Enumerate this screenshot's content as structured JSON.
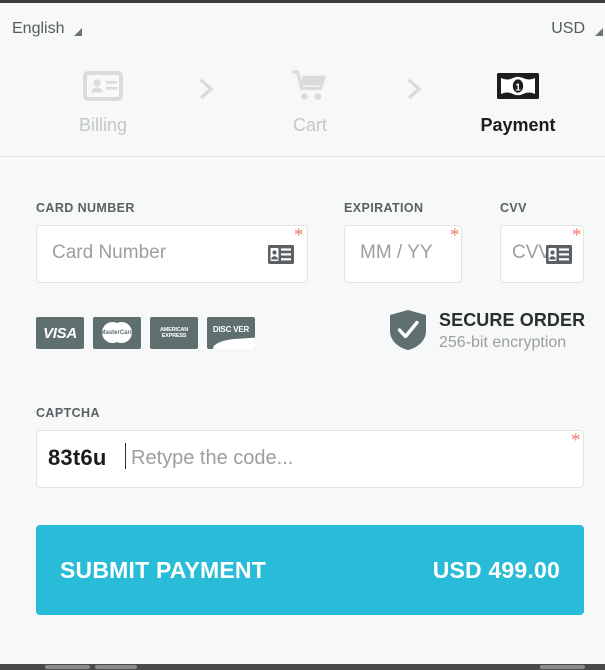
{
  "topbar": {
    "language": "English",
    "currency": "USD",
    "language_caret_icon": "caret-down-icon",
    "currency_caret_icon": "caret-down-icon"
  },
  "steps": [
    {
      "label": "Billing",
      "icon": "id-card-icon",
      "active": false
    },
    {
      "label": "Cart",
      "icon": "shopping-cart-icon",
      "active": false
    },
    {
      "label": "Payment",
      "icon": "banknote-icon",
      "active": true
    }
  ],
  "separators": [
    "chevron-right-icon",
    "chevron-right-icon"
  ],
  "form": {
    "card_number": {
      "label": "CARD NUMBER",
      "placeholder": "Card Number",
      "value": "",
      "required_marker": "*",
      "icon": "credit-card-icon"
    },
    "expiration": {
      "label": "EXPIRATION",
      "placeholder": "MM / YY",
      "value": "",
      "required_marker": "*"
    },
    "cvv": {
      "label": "CVV",
      "placeholder": "CVV",
      "value": "",
      "required_marker": "*",
      "icon": "credit-card-icon"
    },
    "captcha": {
      "label": "CAPTCHA",
      "code": "83t6u",
      "placeholder": "Retype the code...",
      "value": "",
      "required_marker": "*"
    }
  },
  "card_brands": [
    {
      "name": "VISA",
      "text": "VISA"
    },
    {
      "name": "MasterCard",
      "text": "MasterCard"
    },
    {
      "name": "American Express",
      "line1": "AMERICAN",
      "line2": "EXPRESS"
    },
    {
      "name": "Discover",
      "text": "DISC VER"
    }
  ],
  "secure_badge": {
    "icon": "shield-check-icon",
    "title": "SECURE ORDER",
    "subtitle": "256-bit encryption"
  },
  "submit": {
    "label": "SUBMIT PAYMENT",
    "amount": "USD 499.00"
  },
  "colors": {
    "accent": "#29bcd9",
    "brand_gray": "#5f6e6e",
    "required_red": "#f2796e",
    "page_bg": "#f7f8f8",
    "active_text": "#1d1d1d",
    "inactive_text": "#c4c7c8"
  }
}
